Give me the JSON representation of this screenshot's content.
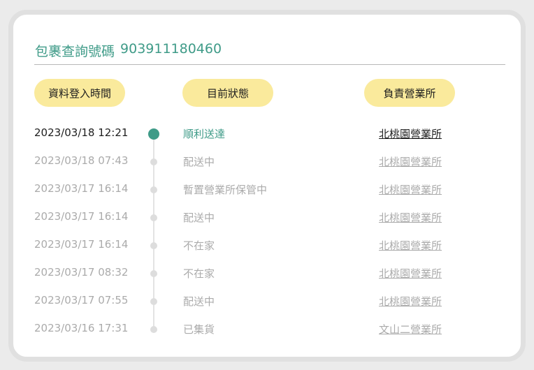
{
  "title": {
    "label": "包裹查詢號碼",
    "tracking_number": "903911180460"
  },
  "headers": {
    "time": "資料登入時間",
    "status": "目前狀態",
    "office": "負責營業所"
  },
  "colors": {
    "accent": "#3f9b88",
    "pill_background": "#faea9c",
    "muted_text": "#ababab"
  },
  "rows": [
    {
      "time": "2023/03/18 12:21",
      "status": "順利送達",
      "office": "北桃園營業所"
    },
    {
      "time": "2023/03/18 07:43",
      "status": "配送中",
      "office": "北桃園營業所"
    },
    {
      "time": "2023/03/17 16:14",
      "status": "暫置營業所保管中",
      "office": "北桃園營業所"
    },
    {
      "time": "2023/03/17 16:14",
      "status": "配送中",
      "office": "北桃園營業所"
    },
    {
      "time": "2023/03/17 16:14",
      "status": "不在家",
      "office": "北桃園營業所"
    },
    {
      "time": "2023/03/17 08:32",
      "status": "不在家",
      "office": "北桃園營業所"
    },
    {
      "time": "2023/03/17 07:55",
      "status": "配送中",
      "office": "北桃園營業所"
    },
    {
      "time": "2023/03/16 17:31",
      "status": "已集貨",
      "office": "文山二營業所"
    }
  ]
}
